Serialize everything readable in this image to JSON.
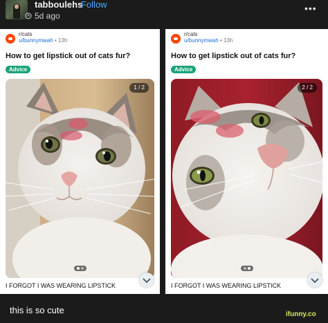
{
  "post": {
    "username": "tabboulehs",
    "follow_label": "Follow",
    "age": "5d ago",
    "more_label": "•••",
    "caption": "this is so cute"
  },
  "cards": [
    {
      "subreddit": "r/cats",
      "user": "u/bunnymwah",
      "age": "13h",
      "title": "How to get lipstick out of cats fur?",
      "flair": "Advice",
      "counter": "1 / 2",
      "caption": "I FORGOT I WAS WEARING LIPSTICK"
    },
    {
      "subreddit": "r/cats",
      "user": "u/bunnymwah",
      "age": "13h",
      "title": "How to get lipstick out of cats fur?",
      "flair": "Advice",
      "counter": "2 / 2",
      "caption": "I FORGOT I WAS WEARING LIPSTICK"
    }
  ],
  "watermark": "ifunny.co",
  "colors": {
    "background": "#1b1b1b",
    "follow": "#4aa8ff",
    "flair": "#1aa37a",
    "subreddit_icon": "#ff4500",
    "lipstick": "#d95a6e"
  }
}
